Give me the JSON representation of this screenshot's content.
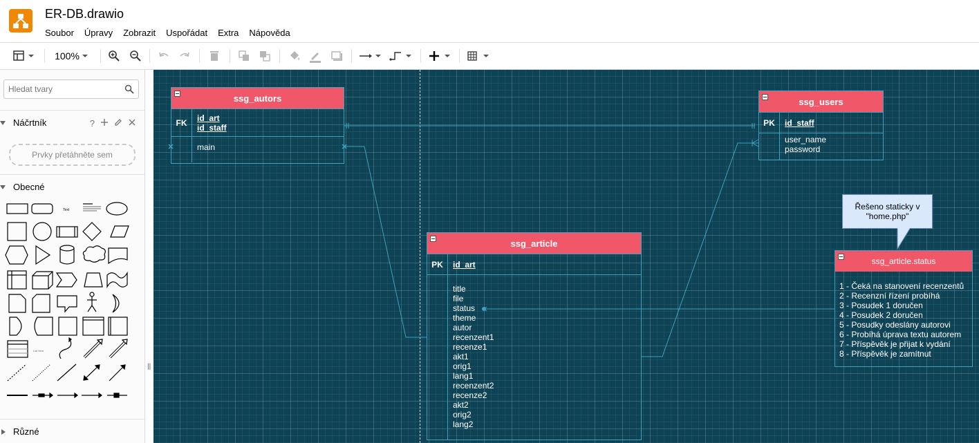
{
  "app": {
    "title": "ER-DB.drawio",
    "logo_icon": "drawio-logo-icon",
    "brand_color": "#f08705"
  },
  "menu": [
    "Soubor",
    "Úpravy",
    "Zobrazit",
    "Uspořádat",
    "Extra",
    "Nápověda"
  ],
  "toolbar": {
    "zoom": "100%"
  },
  "sidebar": {
    "search_placeholder": "Hledat tvary",
    "scratchpad_label": "Náčrtník",
    "scratchpad_help": "?",
    "scratchpad_drop": "Prvky přetáhněte sem",
    "general_label": "Obecné",
    "misc_label": "Různé"
  },
  "canvas": {
    "background": "#0e4255",
    "header_color": "#f0586a",
    "tables": {
      "autors": {
        "name": "ssg_autors",
        "key": "FK",
        "key_fields": [
          "id_art",
          "id_staff"
        ],
        "fields": [
          "main"
        ]
      },
      "users": {
        "name": "ssg_users",
        "key": "PK",
        "key_fields": [
          "id_staff"
        ],
        "fields": [
          "user_name",
          "password"
        ]
      },
      "article": {
        "name": "ssg_article",
        "key": "PK",
        "key_fields": [
          "id_art"
        ],
        "fields": [
          "title",
          "file",
          "status",
          "theme",
          "autor",
          "recenzent1",
          "recenze1",
          "akt1",
          "orig1",
          "lang1",
          "recenzent2",
          "recenze2",
          "akt2",
          "orig2",
          "lang2"
        ]
      },
      "status": {
        "name": "ssg_article.status",
        "lines": [
          "1 - Čeká na stanovení recenzentů",
          "2 - Recenzní řízení probíhá",
          "3 - Posudek 1 doručen",
          "4 - Posudek 2 doručen",
          "5 - Posudky odeslány autorovi",
          "6 - Probíhá úprava textu autorem",
          "7 - Příspěvěk je přijat k vydání",
          "8 - Příspěvěk je zamítnut"
        ]
      }
    },
    "note": {
      "line1": "Řešeno staticky v",
      "line2": "\"home.php\""
    }
  }
}
